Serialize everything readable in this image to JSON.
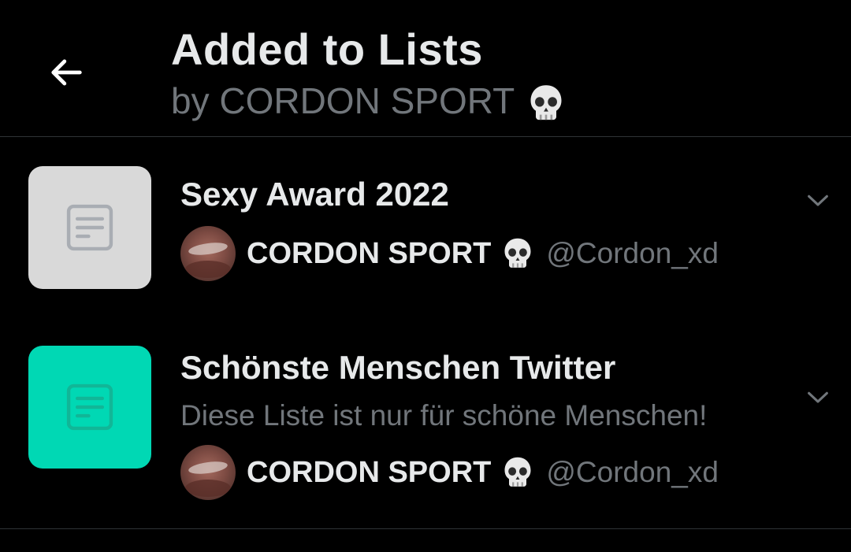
{
  "header": {
    "back_icon": "arrow-left-icon",
    "title": "Added to Lists",
    "subtitle_prefix": "by CORDON SPORT",
    "subtitle_emoji": "skull-emoji"
  },
  "lists": [
    {
      "name": "Sexy Award 2022",
      "description": "",
      "thumb_color": "#d9d9d9",
      "owner": {
        "name": "CORDON SPORT",
        "emoji": "skull-emoji",
        "handle": "@Cordon_xd"
      },
      "menu_icon": "chevron-down-icon"
    },
    {
      "name": "Schönste Menschen Twitter",
      "description": "Diese Liste ist nur für schöne Menschen!",
      "thumb_color": "#00d8b4",
      "owner": {
        "name": "CORDON SPORT",
        "emoji": "skull-emoji",
        "handle": "@Cordon_xd"
      },
      "menu_icon": "chevron-down-icon"
    }
  ],
  "colors": {
    "background": "#000000",
    "primary_text": "#e7e9ea",
    "secondary_text": "#71767b",
    "divider": "#2f3336"
  }
}
